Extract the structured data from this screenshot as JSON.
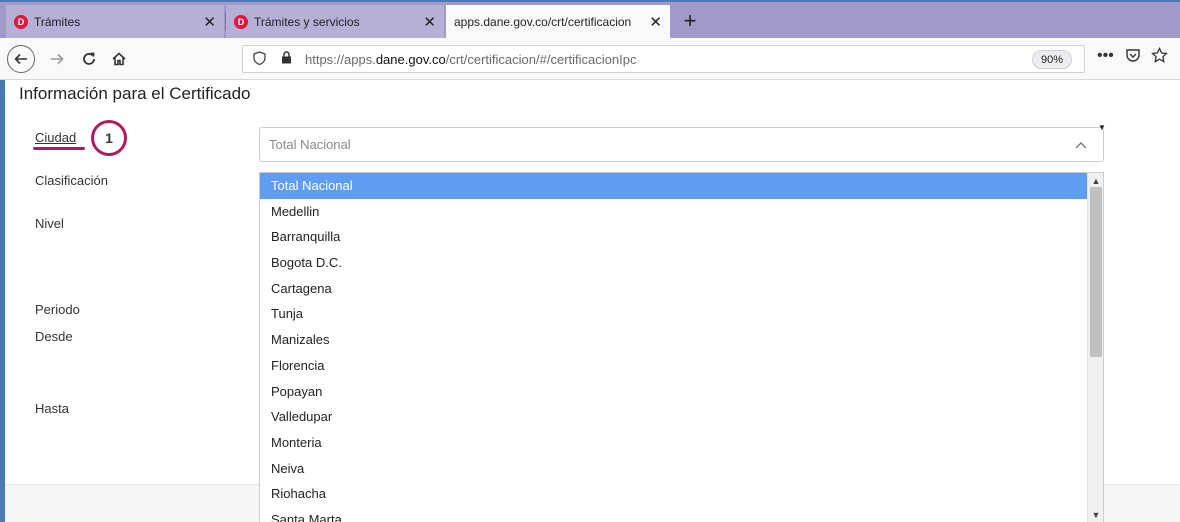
{
  "browser": {
    "tabs": [
      {
        "title": "Trámites",
        "favicon": "D",
        "active": false
      },
      {
        "title": "Trámites y servicios",
        "favicon": "D",
        "active": false
      },
      {
        "title": "apps.dane.gov.co/crt/certificacion",
        "favicon": "",
        "active": true
      }
    ],
    "close_glyph": "✕",
    "new_tab_glyph": "+",
    "url_prefix": "https://apps.",
    "url_domain": "dane.gov.co",
    "url_suffix": "/crt/certificacion/#/certificacionIpc",
    "zoom": "90%",
    "colors": {
      "tab_strip": "#a199c9",
      "accent": "#b21a5a",
      "selected": "#5e9df2"
    }
  },
  "page": {
    "heading": "Información para el Certificado",
    "labels": {
      "city": "Ciudad",
      "classification": "Clasificación",
      "level": "Nivel",
      "period": "Periodo",
      "from": "Desde",
      "to": "Hasta"
    },
    "step_badge": "1",
    "city_select": {
      "value": "Total Nacional",
      "options": [
        "Total Nacional",
        "Medellin",
        "Barranquilla",
        "Bogota D.C.",
        "Cartagena",
        "Tunja",
        "Manizales",
        "Florencia",
        "Popayan",
        "Valledupar",
        "Monteria",
        "Neiva",
        "Riohacha",
        "Santa Marta"
      ],
      "selected_index": 0
    }
  }
}
